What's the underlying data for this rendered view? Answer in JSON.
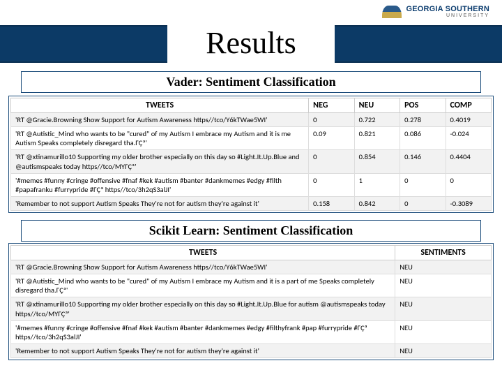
{
  "logo": {
    "name": "GEORGIA SOUTHERN",
    "sub": "UNIVERSITY"
  },
  "title": "Results",
  "section1": "Vader: Sentiment Classification",
  "section2": "Scikit Learn: Sentiment Classification",
  "vader": {
    "head": {
      "tweets": "TWEETS",
      "neg": "NEG",
      "neu": "NEU",
      "pos": "POS",
      "comp": "COMP"
    },
    "rows": [
      {
        "t": "'RT @Gracie.Browning Show Support for Autism Awareness https//tco/Y6kTWae5WI'",
        "neg": "0",
        "neu": "0.722",
        "pos": "0.278",
        "comp": "0.4019"
      },
      {
        "t": "'RT @Autistic_Mind who wants to be \"cured\" of my Autism I embrace my Autism and it is me Autism Speaks completely disregard tha.ГÇª'",
        "neg": "0.09",
        "neu": "0.821",
        "pos": "0.086",
        "comp": "-0.024"
      },
      {
        "t": "'RT @xtinamurillo10 Supporting my older brother especially on this day so #Light.It.Up.Blue and @autismspeaks today https//tco/MYГÇª'",
        "neg": "0",
        "neu": "0.854",
        "pos": "0.146",
        "comp": "0.4404"
      },
      {
        "t": "'#memes #funny #cringe #offensive #fnaf #kek #autism #banter #dankmemes #edgy #filth #papafranku #furrypride #ГÇª https//tco/3h2qS3alJI'",
        "neg": "0",
        "neu": "1",
        "pos": "0",
        "comp": "0"
      },
      {
        "t": "'Remember to not support Autism Speaks They're not for autism they're against it'",
        "neg": "0.158",
        "neu": "0.842",
        "pos": "0",
        "comp": "-0.3089"
      }
    ]
  },
  "scikit": {
    "head": {
      "tweets": "TWEETS",
      "sent": "SENTIMENTS"
    },
    "rows": [
      {
        "t": "'RT @Gracie.Browning Show Support for Autism Awareness https//tco/Y6kTWae5WI'",
        "s": "NEU"
      },
      {
        "t": "'RT @Autistic_Mind who wants to be \"cured\" of my Autism I embrace my Autism and it is a part of me Speaks completely disregard tha.ГÇª'",
        "s": "NEU"
      },
      {
        "t": "'RT @xtinamurillo10 Supporting my older brother especially on this day so #Light.It.Up.Blue for autism @autismspeaks today https//tco/MYГÇª'",
        "s": "NEU"
      },
      {
        "t": "'#memes #funny #cringe #offensive #fnaf #kek #autism #banter #dankmemes #edgy #filthyfrank #pap #furrypride #ГÇª https//tco/3h2qS3alJI'",
        "s": "NEU"
      },
      {
        "t": "'Remember to not support Autism Speaks They're not for autism they're against it'",
        "s": "NEU"
      }
    ]
  }
}
